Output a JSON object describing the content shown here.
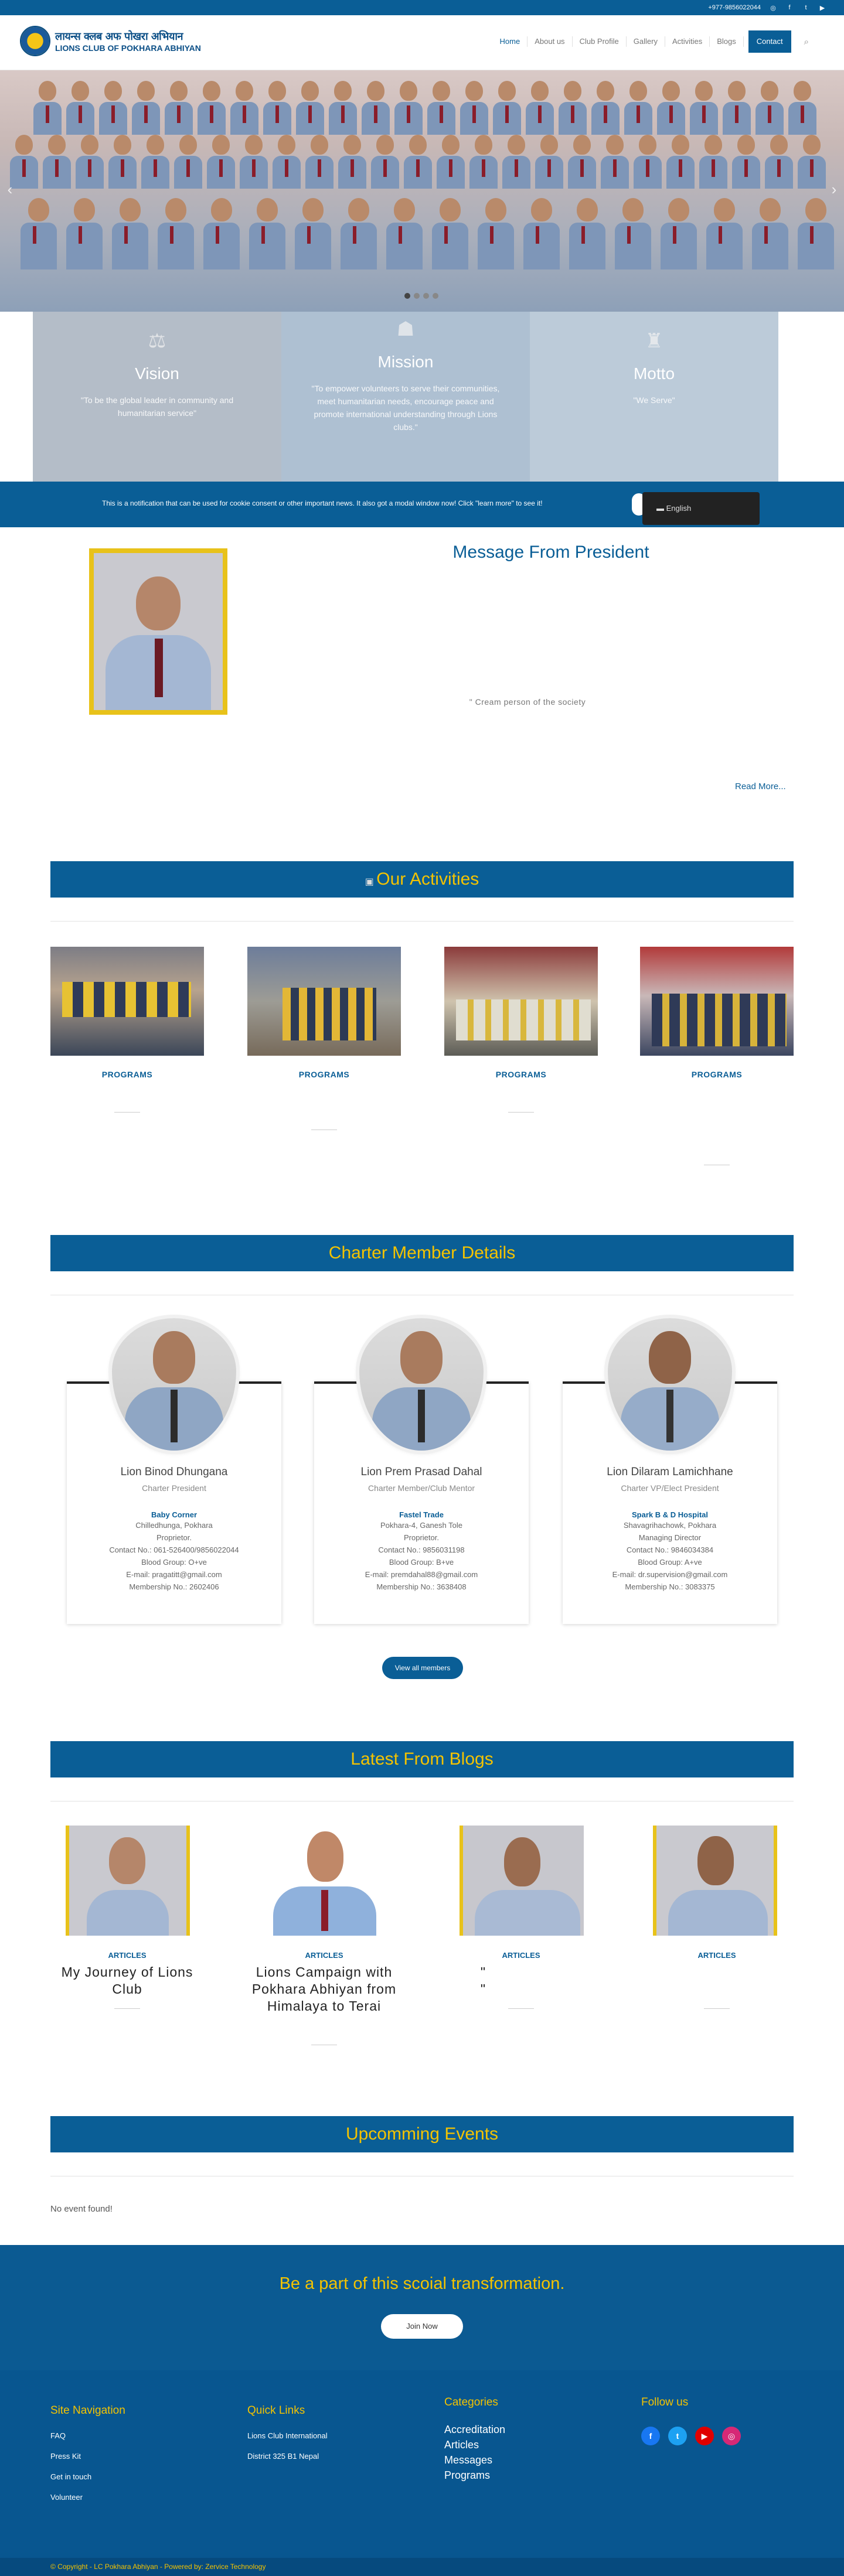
{
  "topbar": {
    "phone": "+977-9856022044"
  },
  "header": {
    "logo_line1": "लायन्स क्लब अफ पोखरा अभियान",
    "logo_line2": "LIONS CLUB OF POKHARA ABHIYAN"
  },
  "nav": {
    "items": [
      "Home",
      "About us",
      "Club Profile",
      "Gallery",
      "Activities",
      "Blogs"
    ],
    "contact": "Contact"
  },
  "vmm": [
    {
      "title": "Vision",
      "text": "\"To be the global leader in community and humanitarian service\""
    },
    {
      "title": "Mission",
      "text": "\"To empower volunteers to serve their communities, meet humanitarian needs, encourage peace and promote international understanding through Lions clubs.\""
    },
    {
      "title": "Motto",
      "text": "\"We Serve\""
    }
  ],
  "notice": {
    "text": "This is a notification that can be used for cookie consent or other important news. It also got a modal window now! Click \"learn more\" to see it!",
    "language": "English"
  },
  "president": {
    "title": "Message From President",
    "quote": "\" Cream person of the society",
    "read_more": "Read More..."
  },
  "activities": {
    "title": "Our Activities",
    "items": [
      {
        "label": "PROGRAMS"
      },
      {
        "label": "PROGRAMS"
      },
      {
        "label": "PROGRAMS"
      },
      {
        "label": "PROGRAMS"
      }
    ]
  },
  "members": {
    "title": "Charter Member Details",
    "view_all": "View all members",
    "items": [
      {
        "name": "Lion Binod Dhungana",
        "role": "Charter President",
        "biz": "Baby Corner",
        "lines": [
          "Chilledhunga, Pokhara",
          "Proprietor.",
          "Contact No.: 061-526400/9856022044",
          "Blood Group: O+ve",
          "E-mail: pragatitt@gmail.com",
          "Membership No.: 2602406"
        ]
      },
      {
        "name": "Lion Prem Prasad Dahal",
        "role": "Charter Member/Club Mentor",
        "biz": "Fastel Trade",
        "lines": [
          "Pokhara-4, Ganesh Tole",
          "Proprietor.",
          "Contact No.: 9856031198",
          "Blood Group: B+ve",
          "E-mail: premdahal88@gmail.com",
          "Membership No.: 3638408"
        ]
      },
      {
        "name": "Lion Dilaram Lamichhane",
        "role": "Charter VP/Elect President",
        "biz": "Spark B & D Hospital",
        "lines": [
          "Shavagrihachowk, Pokhara",
          "Managing Director",
          "Contact No.: 9846034384",
          "Blood Group: A+ve",
          "E-mail: dr.supervision@gmail.com",
          "Membership No.: 3083375"
        ]
      }
    ]
  },
  "blogs": {
    "title": "Latest From Blogs",
    "items": [
      {
        "label": "ARTICLES",
        "title": "My Journey of Lions Club"
      },
      {
        "label": "ARTICLES",
        "title": "Lions Campaign with Pokhara Abhiyan from Himalaya to Terai"
      },
      {
        "label": "ARTICLES",
        "title": "\" \""
      },
      {
        "label": "ARTICLES",
        "title": ""
      }
    ]
  },
  "events": {
    "title": "Upcomming Events",
    "empty": "No event found!"
  },
  "cta": {
    "title": "Be a part of this scoial transformation.",
    "button": "Join Now"
  },
  "footer": {
    "nav_title": "Site Navigation",
    "nav_links": [
      "FAQ",
      "Press Kit",
      "Get in touch",
      "Volunteer"
    ],
    "quick_title": "Quick Links",
    "quick_links": [
      "Lions Club International",
      "District 325 B1 Nepal"
    ],
    "cat_title": "Categories",
    "categories": [
      "Accreditation",
      "Articles",
      "Messages",
      "Programs"
    ],
    "follow_title": "Follow us",
    "copyright": "© Copyright - LC Pokhara Abhiyan - Powered by: Zervice Technology"
  },
  "colors": {
    "primary": "#0a5e96",
    "accent": "#f4c300",
    "facebook": "#1877f2",
    "twitter": "#1da1f2",
    "youtube": "#e00000",
    "instagram": "#d62976"
  }
}
